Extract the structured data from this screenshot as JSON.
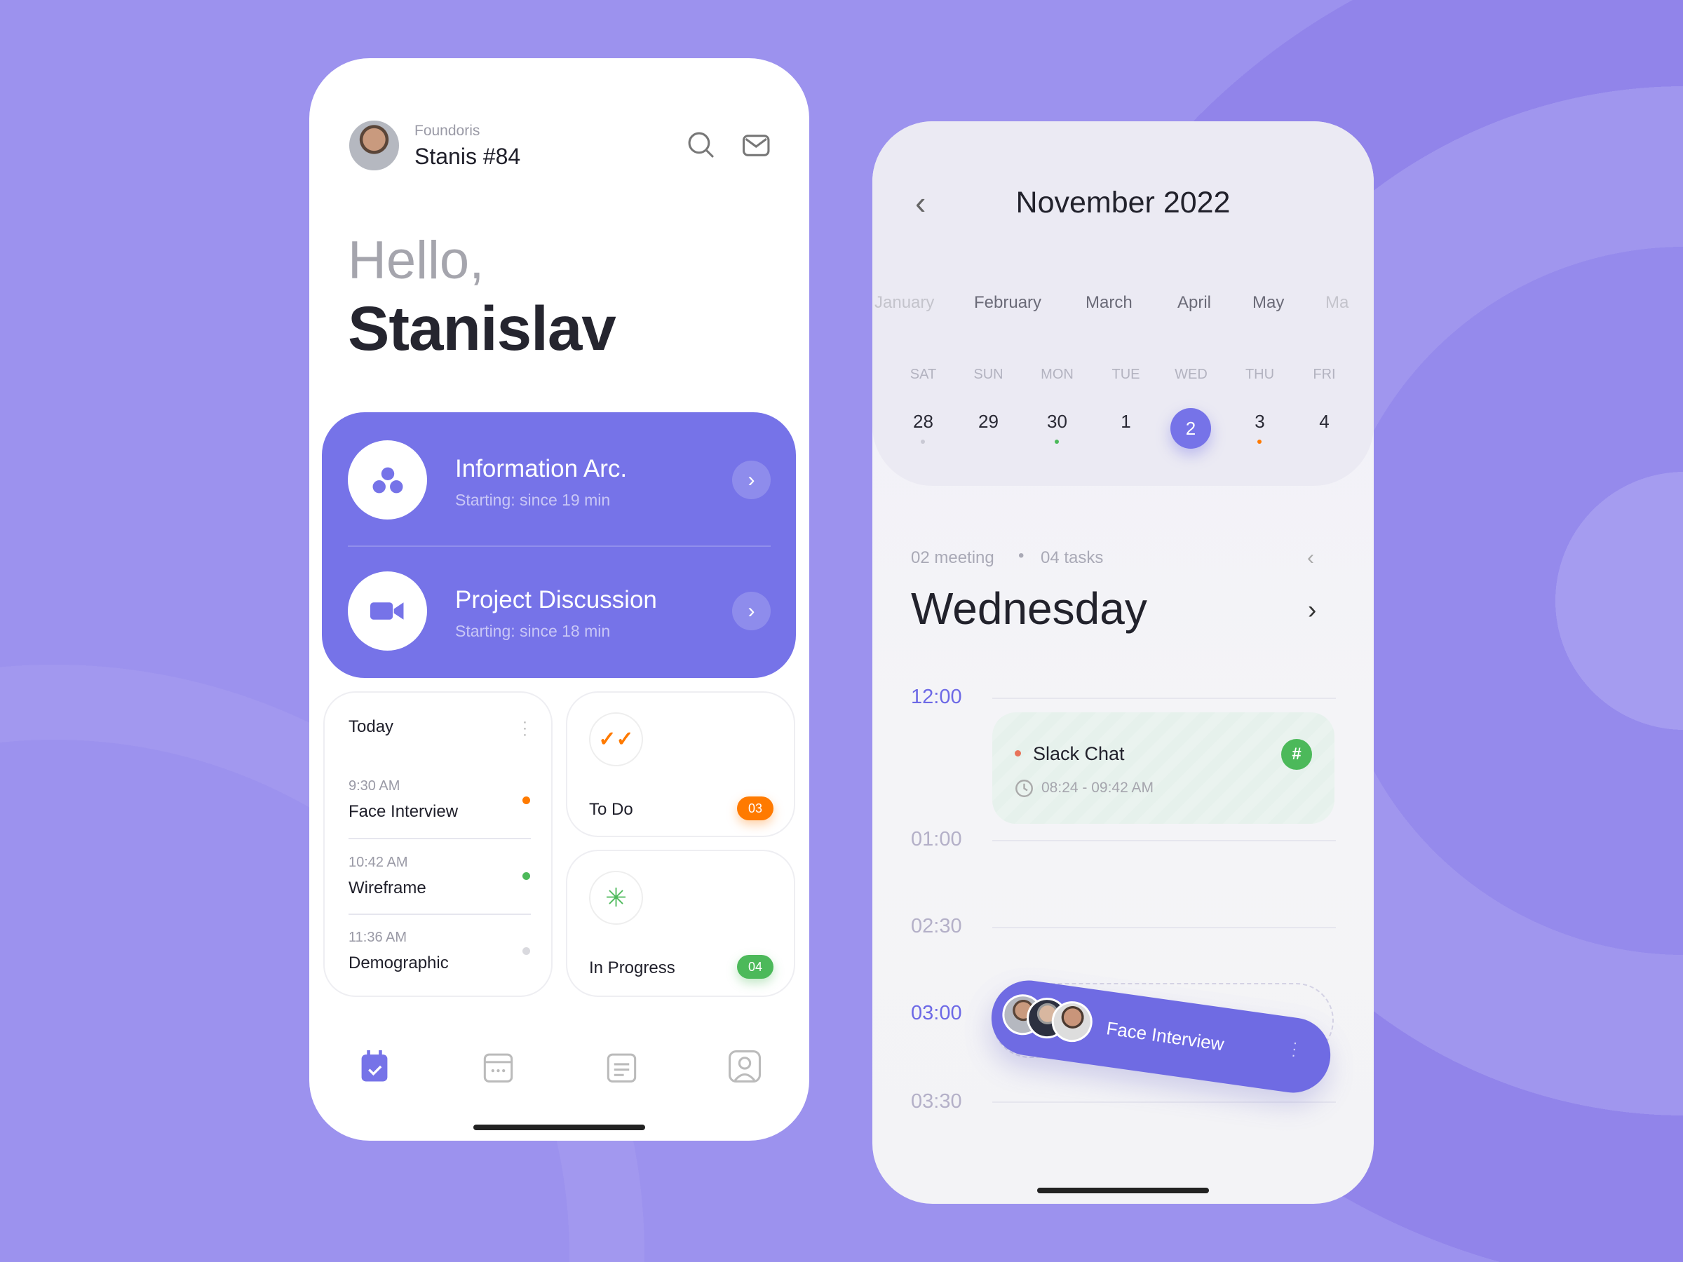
{
  "home": {
    "org": "Foundoris",
    "user": "Stanis #84",
    "greeting": "Hello,",
    "name": "Stanislav",
    "meetings": [
      {
        "title": "Information Arc.",
        "subtitle": "Starting: since 19 min",
        "icon": "people-icon"
      },
      {
        "title": "Project Discussion",
        "subtitle": "Starting: since 18 min",
        "icon": "video-camera-icon"
      }
    ],
    "today": {
      "title": "Today",
      "items": [
        {
          "time": "9:30 AM",
          "title": "Face Interview",
          "color": "#ff7a00"
        },
        {
          "time": "10:42 AM",
          "title": "Wireframe",
          "color": "#4cb95a"
        },
        {
          "time": "11:36 AM",
          "title": "Demographic",
          "color": "#d9d9de"
        }
      ]
    },
    "todo": {
      "label": "To Do",
      "count": "03",
      "color": "#ff7a00"
    },
    "progress": {
      "label": "In Progress",
      "count": "04",
      "color": "#4cb95a"
    },
    "nav": [
      "calendar-check-icon",
      "calendar-icon",
      "notes-icon",
      "profile-icon"
    ]
  },
  "calendar": {
    "title": "November 2022",
    "months": [
      "January",
      "February",
      "March",
      "April",
      "May",
      "Ma"
    ],
    "days": [
      {
        "dow": "SAT",
        "num": "28"
      },
      {
        "dow": "SUN",
        "num": "29"
      },
      {
        "dow": "MON",
        "num": "30"
      },
      {
        "dow": "TUE",
        "num": "1"
      },
      {
        "dow": "WED",
        "num": "2"
      },
      {
        "dow": "THU",
        "num": "3"
      },
      {
        "dow": "FRI",
        "num": "4"
      }
    ],
    "summary_meetings": "02 meeting",
    "summary_tasks": "04 tasks",
    "weekday": "Wednesday",
    "times": [
      "12:00",
      "01:00",
      "02:30",
      "03:00",
      "03:30"
    ],
    "slack": {
      "title": "Slack Chat",
      "time": "08:24 - 09:42 AM"
    },
    "interview": {
      "title": "Face Interview"
    },
    "accent": "#7673e8"
  }
}
